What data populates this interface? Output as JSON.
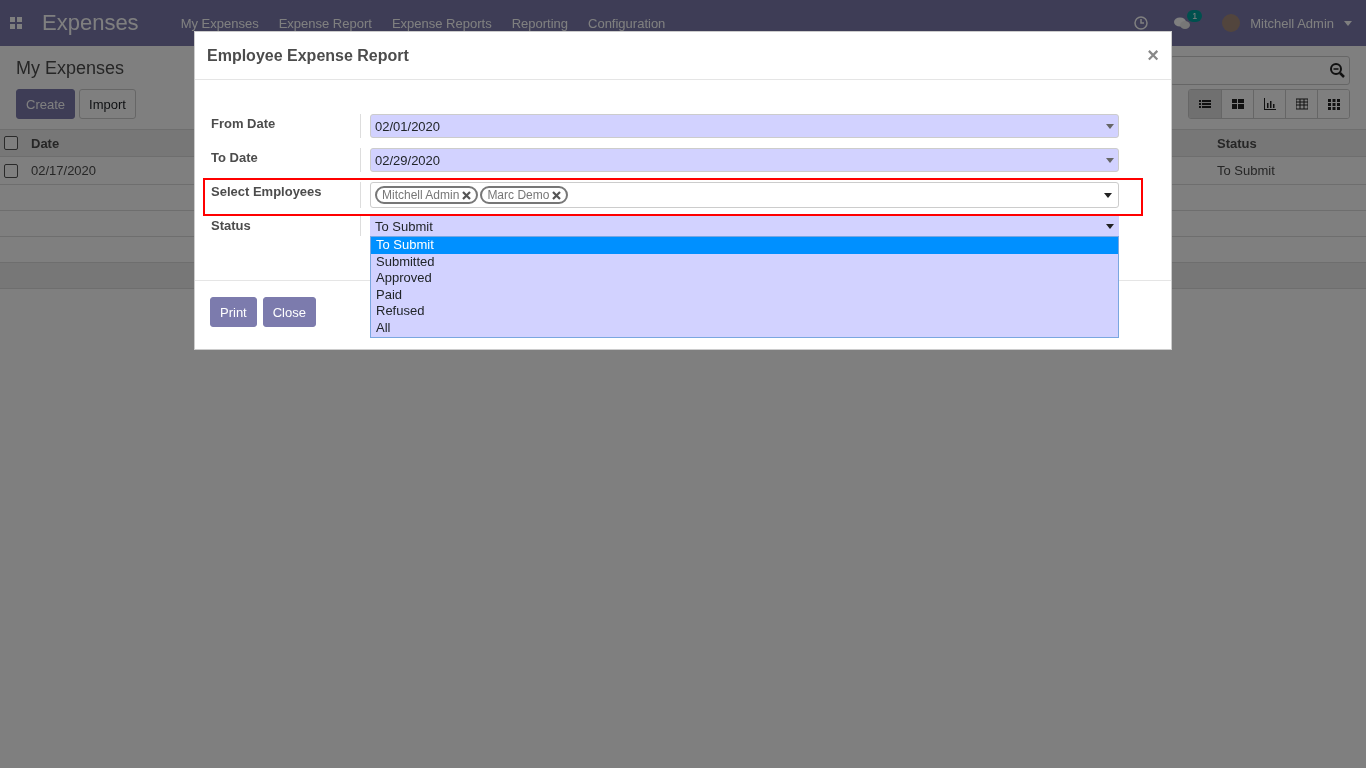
{
  "navbar": {
    "app_title": "Expenses",
    "menu": [
      "My Expenses",
      "Expense Report",
      "Expense Reports",
      "Reporting",
      "Configuration"
    ],
    "message_count": "1",
    "user": "Mitchell Admin"
  },
  "control_panel": {
    "breadcrumb": "My Expenses",
    "buttons": [
      "Create",
      "Import"
    ],
    "views": [
      {
        "kind": "list",
        "selected": true
      },
      {
        "kind": "kanban",
        "selected": false
      },
      {
        "kind": "graph",
        "selected": false
      },
      {
        "kind": "pivot",
        "selected": false
      },
      {
        "kind": "grid",
        "selected": false
      }
    ]
  },
  "table": {
    "select_all_checked": false,
    "columns": [
      "Date",
      "Status"
    ],
    "rows": [
      {
        "date": "02/17/2020",
        "status": "To Submit",
        "checked": false
      }
    ]
  },
  "dialog": {
    "title": "Employee Expense Report",
    "close_glyph": "×",
    "fields": [
      {
        "kind": "date",
        "label": "From Date",
        "value": "02/01/2020",
        "highlighted": false
      },
      {
        "kind": "date",
        "label": "To Date",
        "value": "02/29/2020",
        "highlighted": false
      },
      {
        "kind": "tags",
        "label": "Select Employees",
        "tags": [
          "Mitchell Admin",
          "Marc Demo"
        ],
        "highlighted": true
      },
      {
        "kind": "select",
        "label": "Status",
        "value": "To Submit",
        "highlighted": false,
        "expanded": true,
        "options": [
          {
            "label": "To Submit",
            "selected": true
          },
          {
            "label": "Submitted",
            "selected": false
          },
          {
            "label": "Approved",
            "selected": false
          },
          {
            "label": "Paid",
            "selected": false
          },
          {
            "label": "Refused",
            "selected": false
          },
          {
            "label": "All",
            "selected": false
          }
        ]
      }
    ],
    "buttons": [
      "Print",
      "Close"
    ]
  }
}
